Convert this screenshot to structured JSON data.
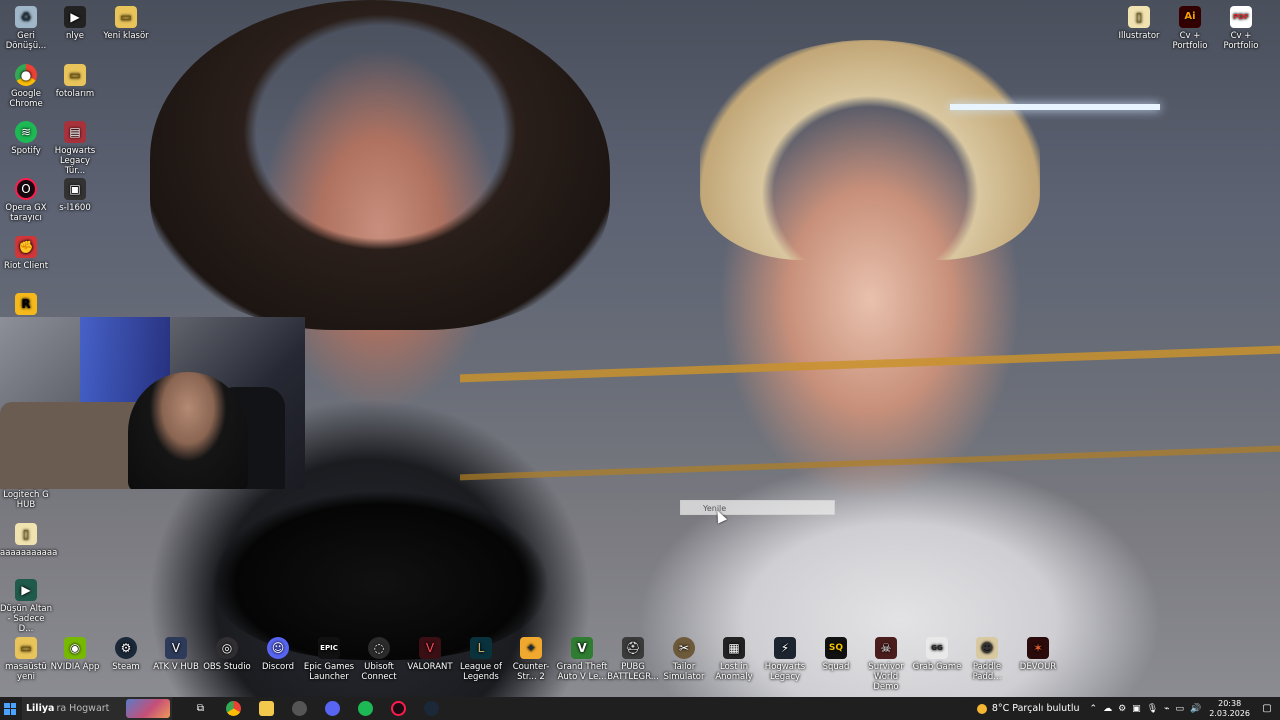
{
  "desktop": {
    "context_menu": {
      "item": "Yenile"
    },
    "icons": {
      "recycle_bin": "Geri Dönüşü...",
      "nlye": "nlye",
      "new_folder": "Yeni klasör",
      "chrome": "Google Chrome",
      "photos": "fotolarım",
      "spotify": "Spotify",
      "hogwarts_tr": "Hogwarts Legacy Tür...",
      "opera": "Opera GX tarayıcı",
      "s1600": "s-l1600",
      "riot": "Riot Client",
      "logitech": "Logitech G HUB",
      "file_a": "aaaaaaaaaaa",
      "dusun": "Düşün Altan - Sadece D...",
      "illustrator": "Illustrator",
      "cv_ai": "Cv + Portfolio",
      "cv_pdf": "Cv + Portfolio",
      "masaustu": "masaüstü yeni",
      "nvidia": "NVIDIA App",
      "steam": "Steam",
      "atk": "ATK V HUB",
      "obs": "OBS Studio",
      "discord": "Discord",
      "epic": "Epic Games Launcher",
      "ubisoft": "Ubisoft Connect",
      "valorant": "VALORANT",
      "lol": "League of Legends",
      "cs2": "Counter-Str... 2",
      "gta": "Grand Theft Auto V Le...",
      "pubg": "PUBG BATTLEGR...",
      "tailor": "Tailor Simulator",
      "lost": "Lost in Anomaly",
      "hogwarts": "Hogwarts Legacy",
      "squad": "Squad",
      "survivor": "Survivor World Demo",
      "grab": "Grab Game",
      "paddle": "Paddle Padd...",
      "devour": "DEVOUR"
    }
  },
  "taskbar": {
    "search_query": "Liliya",
    "search_rest": "ra Hogwart",
    "weather": "8°C  Parçalı bulutlu",
    "time": "20:38",
    "date": "2.03.2026"
  },
  "colors": {
    "taskbar_bg": "#1f1f1f",
    "accent": "#4aa3ff"
  }
}
